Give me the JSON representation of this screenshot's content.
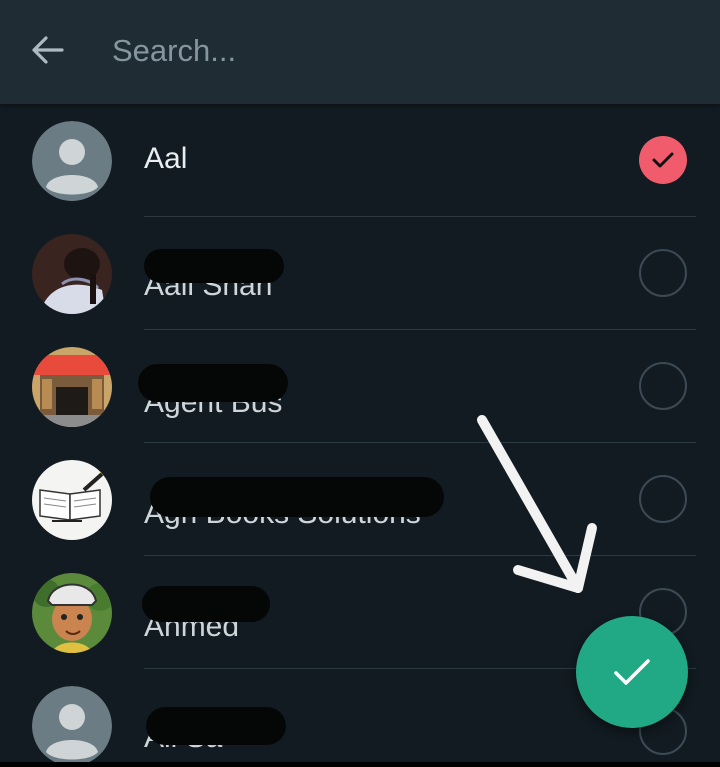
{
  "search": {
    "placeholder": "Search..."
  },
  "contacts": [
    {
      "name": "Aal",
      "selected": true,
      "avatar": "default-avatar-icon"
    },
    {
      "name": "Aali Shah",
      "selected": false,
      "avatar": "photo"
    },
    {
      "name": "Agent Bus",
      "selected": false,
      "avatar": "photo"
    },
    {
      "name": "Agri Books Solutions",
      "selected": false,
      "avatar": "photo"
    },
    {
      "name": "Ahmed",
      "selected": false,
      "avatar": "photo"
    },
    {
      "name": "Ali Sa",
      "selected": false,
      "avatar": "default-avatar-icon"
    }
  ],
  "colors": {
    "background": "#121b22",
    "header": "#1f2c33",
    "selected_check": "#f15c6d",
    "fab": "#21a884",
    "divider": "#2a3942"
  },
  "fab": {
    "icon": "check-icon"
  }
}
